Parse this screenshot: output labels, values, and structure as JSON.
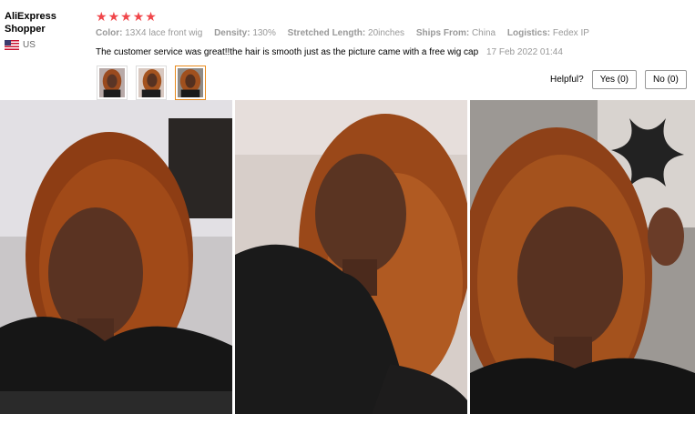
{
  "user": {
    "name": "AliExpress Shopper",
    "country": "US",
    "flag_icon": "us-flag-icon"
  },
  "rating": {
    "stars": 5,
    "max": 5,
    "color": "#f0464a"
  },
  "attributes": [
    {
      "label": "Color:",
      "value": "13X4 lace front wig"
    },
    {
      "label": "Density:",
      "value": "130%"
    },
    {
      "label": "Stretched Length:",
      "value": "20inches"
    },
    {
      "label": "Ships From:",
      "value": "China"
    },
    {
      "label": "Logistics:",
      "value": "Fedex IP"
    }
  ],
  "review": {
    "text": "The customer service was great!!the hair is smooth just as the picture came with a free wig cap",
    "date": "17 Feb 2022 01:44"
  },
  "thumbnails": {
    "count": 3,
    "active_index": 2,
    "active_color": "#e88a1c"
  },
  "helpful": {
    "label": "Helpful?",
    "yes": "Yes (0)",
    "no": "No (0)"
  },
  "photos": {
    "count": 3
  }
}
